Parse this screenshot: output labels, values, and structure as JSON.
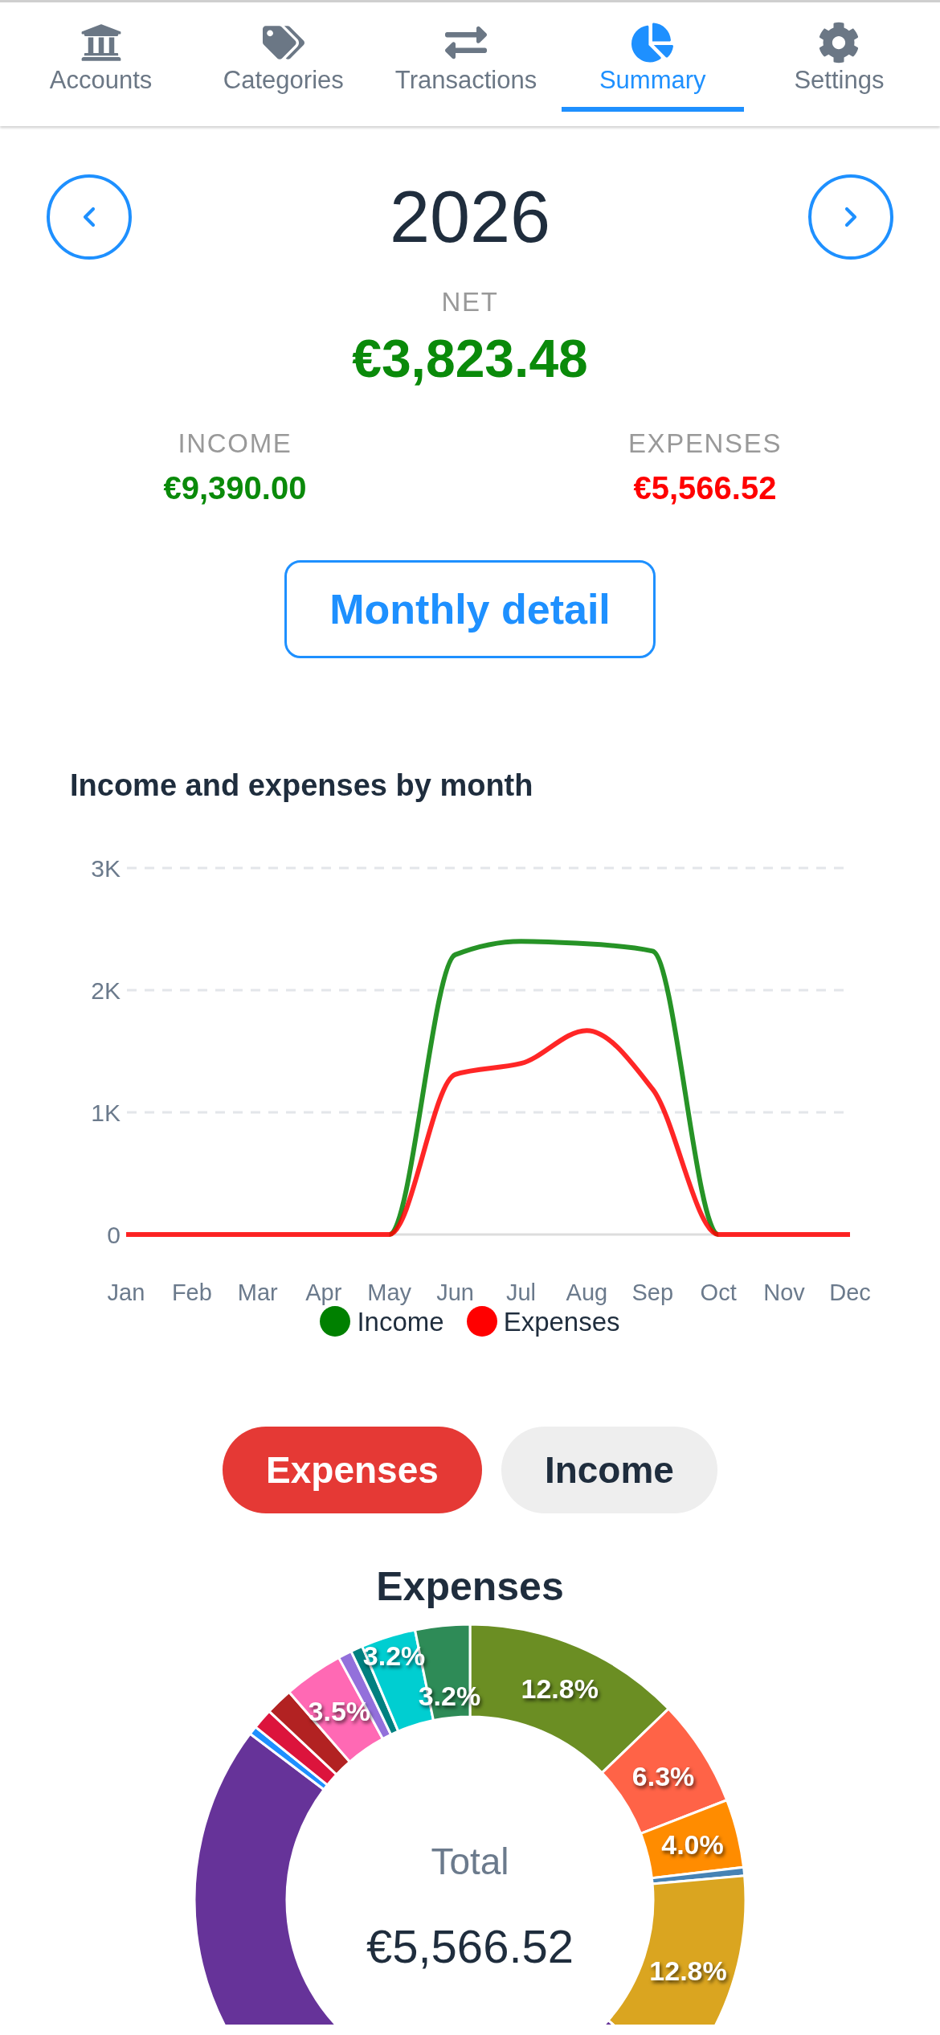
{
  "tabs": [
    {
      "label": "Accounts",
      "selected": false
    },
    {
      "label": "Categories",
      "selected": false
    },
    {
      "label": "Transactions",
      "selected": false
    },
    {
      "label": "Summary",
      "selected": true
    },
    {
      "label": "Settings",
      "selected": false
    }
  ],
  "year": "2026",
  "net": {
    "label": "NET",
    "amount": "€3,823.48"
  },
  "totals": [
    {
      "label": "INCOME",
      "amount": "€9,390.00",
      "kind": "income"
    },
    {
      "label": "EXPENSES",
      "amount": "€5,566.52",
      "kind": "expense"
    }
  ],
  "detail_button": "Monthly detail",
  "monthly_chart": {
    "chart_data": {
      "type": "line",
      "title": "Income and expenses by month",
      "categories": [
        "Jan",
        "Feb",
        "Mar",
        "Apr",
        "May",
        "Jun",
        "Jul",
        "Aug",
        "Sep",
        "Oct",
        "Nov",
        "Dec"
      ],
      "ylim": [
        0,
        3000
      ],
      "yticks": [
        {
          "value": 0,
          "label": "0"
        },
        {
          "value": 1000,
          "label": "1K"
        },
        {
          "value": 2000,
          "label": "2K"
        },
        {
          "value": 3000,
          "label": "3K"
        }
      ],
      "series": [
        {
          "name": "Income",
          "color": "#008000",
          "values": [
            null,
            null,
            null,
            null,
            0,
            2290,
            2400,
            2380,
            2320,
            0,
            null,
            null
          ]
        },
        {
          "name": "Expenses",
          "color": "#ff0000",
          "values": [
            0,
            0,
            0,
            0,
            0,
            1310,
            1400,
            1670,
            1190,
            0,
            0,
            0
          ]
        }
      ],
      "legend": true
    }
  },
  "toggle": [
    {
      "label": "Expenses",
      "selected": true
    },
    {
      "label": "Income",
      "selected": false
    }
  ],
  "breakdown": {
    "center_label": "Total",
    "center_value": "€5,566.52",
    "chart_data": {
      "type": "donut",
      "title": "Expenses",
      "values": [
        12.8,
        6.3,
        4.0,
        0.5,
        12.8,
        48.9,
        0.5,
        1.2,
        1.6,
        3.5,
        0.8,
        0.7,
        3.2,
        3.2
      ],
      "value_labels": [
        "12.8%",
        "6.3%",
        "4.0%",
        null,
        "12.8%",
        null,
        null,
        null,
        null,
        "3.5%",
        null,
        null,
        "3.2%",
        "3.2%"
      ]
    },
    "slices": [
      {
        "color": "#6b8e23"
      },
      {
        "color": "#ff6347"
      },
      {
        "color": "#ff8c00"
      },
      {
        "color": "#4682b4"
      },
      {
        "color": "#daa520"
      },
      {
        "color": "#663399"
      },
      {
        "color": "#1e90ff"
      },
      {
        "color": "#dc143c"
      },
      {
        "color": "#b22222"
      },
      {
        "color": "#ff69b4"
      },
      {
        "color": "#9370db"
      },
      {
        "color": "#008080"
      },
      {
        "color": "#00ced1"
      },
      {
        "color": "#2e8b57"
      }
    ]
  }
}
